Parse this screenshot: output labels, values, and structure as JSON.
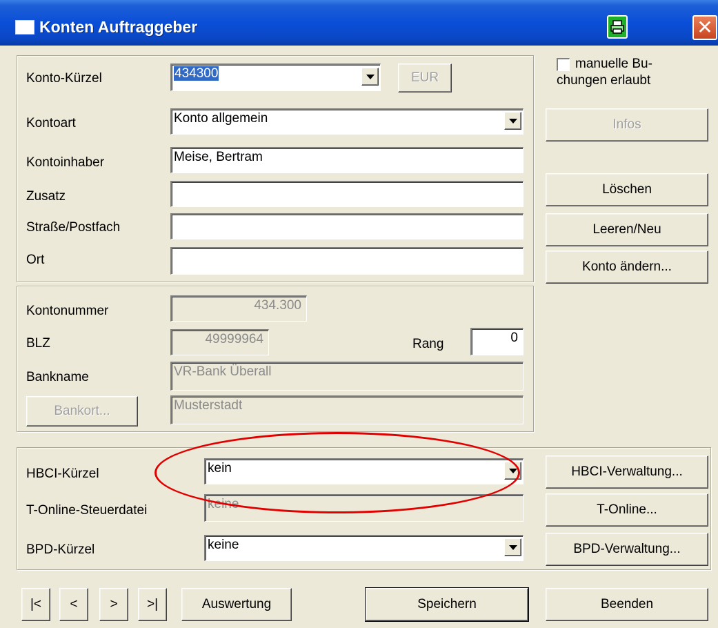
{
  "window": {
    "title": "Konten Auftraggeber",
    "print_icon": "printer-icon",
    "close_glyph": "✕"
  },
  "account": {
    "kuerzel_label": "Konto-Kürzel",
    "kuerzel_value": "434300",
    "currency_label": "EUR",
    "kontoart_label": "Kontoart",
    "kontoart_value": "Konto allgemein",
    "inhaber_label": "Kontoinhaber",
    "inhaber_value": "Meise, Bertram",
    "zusatz_label": "Zusatz",
    "zusatz_value": "",
    "strasse_label": "Straße/Postfach",
    "strasse_value": "",
    "ort_label": "Ort",
    "ort_value": ""
  },
  "bank": {
    "kontonummer_label": "Kontonummer",
    "kontonummer_value": "434.300",
    "blz_label": "BLZ",
    "blz_value": "49999964",
    "rang_label": "Rang",
    "rang_value": "0",
    "bankname_label": "Bankname",
    "bankname_value": "VR-Bank Überall",
    "bankort_button": "Bankort...",
    "bankort_value": "Musterstadt"
  },
  "side": {
    "manual_line1": "manuelle Bu-",
    "manual_line2": "chungen erlaubt",
    "infos": "Infos",
    "loeschen": "Löschen",
    "leeren": "Leeren/Neu",
    "konto_aendern": "Konto ändern..."
  },
  "hbci": {
    "hbci_label": "HBCI-Kürzel",
    "hbci_value": "kein",
    "tonline_label": "T-Online-Steuerdatei",
    "tonline_value": "keine",
    "bpd_label": "BPD-Kürzel",
    "bpd_value": "keine",
    "hbci_button": "HBCI-Verwaltung...",
    "tonline_button": "T-Online...",
    "bpd_button": "BPD-Verwaltung..."
  },
  "footer": {
    "first": "|<",
    "prev": "<",
    "next": ">",
    "last": ">|",
    "auswertung": "Auswertung",
    "speichern": "Speichern",
    "beenden": "Beenden"
  },
  "colors": {
    "titlebar": "#0a4ed8",
    "highlight": "#e00000",
    "selection": "#316ac5"
  }
}
